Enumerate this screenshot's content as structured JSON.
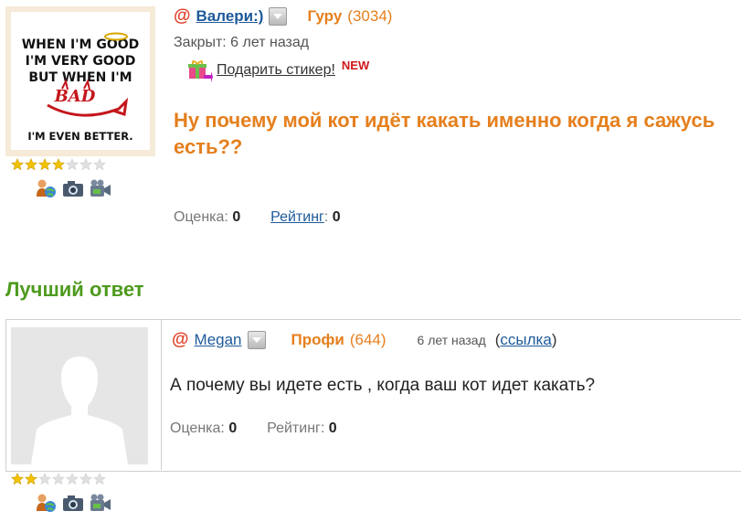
{
  "question": {
    "avatar_text": [
      "WHEN I'M GOOD",
      "I'M VERY GOOD",
      "BUT WHEN I'M",
      "BAD",
      "I'M EVEN BETTER."
    ],
    "author": "Валери:)",
    "rank": "Гуру",
    "rank_points": "(3034)",
    "closed": "Закрыт: 6 лет назад",
    "gift_label": "Подарить стикер!",
    "new_badge": "NEW",
    "title": "Ну почему мой кот идёт какать именно когда я сажусь есть??",
    "score_label": "Оценка:",
    "score_value": "0",
    "rating_label": "Рейтинг",
    "rating_colon": ":",
    "rating_value": "0",
    "stars_filled": 4,
    "stars_total": 7
  },
  "best_answer_heading": "Лучший ответ",
  "answer": {
    "author": "Megan",
    "rank": "Профи",
    "rank_points": "(644)",
    "time": "6 лет назад",
    "link_open": "(",
    "link_label": "ссылка",
    "link_close": ")",
    "text": "А почему вы идете есть , когда ваш кот идет какать?",
    "score_label": "Оценка:",
    "score_value": "0",
    "rating_label": "Рейтинг:",
    "rating_value": "0",
    "stars_filled": 2,
    "stars_total": 7
  },
  "colors": {
    "accent_orange": "#e57f1d",
    "link_blue": "#1d5a9a",
    "best_green": "#4e9a1e",
    "at_red": "#e0422a",
    "star_gold": "#f2c200",
    "star_gray": "#e0e0e0"
  },
  "icons": [
    "at-sign-icon",
    "dropdown-arrow-icon",
    "gift-icon",
    "user-globe-icon",
    "camera-icon",
    "video-camera-icon",
    "star-icon",
    "default-avatar-silhouette"
  ]
}
